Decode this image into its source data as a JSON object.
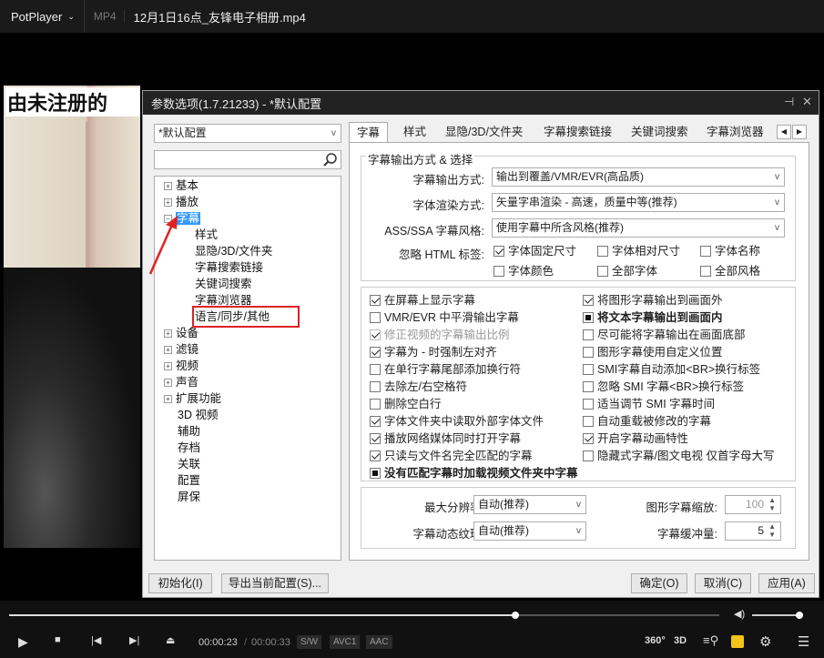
{
  "app": {
    "name": "PotPlayer",
    "format": "MP4",
    "file_title": "12月1日16点_友锋电子相册.mp4"
  },
  "video": {
    "caption": "由未注册的"
  },
  "dialog": {
    "title": "参数选项(1.7.21233) - *默认配置",
    "pin": "⊣",
    "close": "✕",
    "profile": "*默认配置",
    "search_icon": "search-icon",
    "tree": {
      "basic": "基本",
      "playback": "播放",
      "subtitle": "字幕",
      "sub_children": [
        "样式",
        "显隐/3D/文件夹",
        "字幕搜索链接",
        "关键词搜索",
        "字幕浏览器",
        "语言/同步/其他"
      ],
      "device": "设备",
      "filter": "滤镜",
      "video": "视频",
      "audio": "声音",
      "ext": "扩展功能",
      "v3d": "3D 视频",
      "assist": "辅助",
      "archive": "存档",
      "assoc": "关联",
      "config": "配置",
      "screensaver": "屏保"
    },
    "tabs": [
      "字幕",
      "样式",
      "显隐/3D/文件夹",
      "字幕搜索链接",
      "关键词搜索",
      "字幕浏览器"
    ],
    "tab_prev": "◀",
    "tab_next": "▶",
    "section_title": "字幕输出方式 & 选择",
    "output_label": "字幕输出方式:",
    "output_value": "输出到覆盖/VMR/EVR(高品质)",
    "render_label": "字体渲染方式:",
    "render_value": "矢量字串渲染 - 高速，质量中等(推荐)",
    "ass_label": "ASS/SSA 字幕风格:",
    "ass_value": "使用字幕中所含风格(推荐)",
    "ignore_label": "忽略 HTML 标签:",
    "ignore_opts": [
      "字体固定尺寸",
      "字体相对尺寸",
      "字体名称",
      "字体颜色",
      "全部字体",
      "全部风格"
    ],
    "left_opts": [
      "在屏幕上显示字幕",
      "VMR/EVR 中平滑输出字幕",
      "修正视频的字幕输出比例",
      "字幕为 - 时强制左对齐",
      "在单行字幕尾部添加换行符",
      "去除左/右空格符",
      "删除空白行",
      "字体文件夹中读取外部字体文件",
      "播放网络媒体同时打开字幕",
      "只读与文件名完全匹配的字幕"
    ],
    "right_opts": [
      "将图形字幕输出到画面外",
      "将文本字幕输出到画面内",
      "尽可能将字幕输出在画面底部",
      "图形字幕使用自定义位置",
      "SMI字幕自动添加<BR>换行标签",
      "忽略 SMI 字幕<BR>换行标签",
      "适当调节 SMI 字幕时间",
      "自动重载被修改的字幕",
      "开启字幕动画特性",
      "隐藏式字幕/图文电视 仅首字母大写"
    ],
    "bottom_opt": "没有匹配字幕时加载视频文件夹中字幕",
    "maxres_label": "最大分辨率:",
    "maxres_value": "自动(推荐)",
    "anim_label": "字幕动态纹理:",
    "anim_value": "自动(推荐)",
    "scale_label": "图形字幕缩放:",
    "scale_value": "100",
    "buffer_label": "字幕缓冲量:",
    "buffer_value": "5",
    "btn_init": "初始化(I)",
    "btn_export": "导出当前配置(S)...",
    "btn_ok": "确定(O)",
    "btn_cancel": "取消(C)",
    "btn_apply": "应用(A)"
  },
  "player": {
    "time_current": "00:00:23",
    "time_sep": "/",
    "time_total": "00:00:33",
    "badges": [
      "S/W",
      "AVC1",
      "AAC"
    ],
    "progress_fraction": 0.71,
    "icons": [
      "play-icon",
      "stop-icon",
      "prev-icon",
      "next-icon",
      "eject-icon",
      "360-icon",
      "3d-icon",
      "subtitle-search-icon",
      "subtitle-icon",
      "settings-icon",
      "menu-icon"
    ],
    "v360": "360°",
    "v3d": "3D"
  },
  "colors": {
    "highlight_red": "#dd2222",
    "selection_blue": "#3399ff"
  }
}
